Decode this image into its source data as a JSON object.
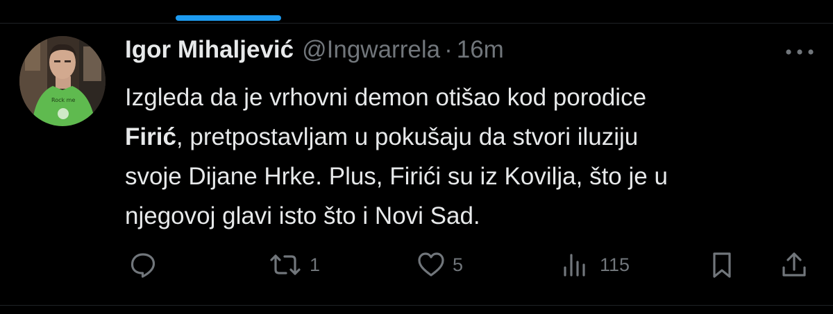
{
  "tweet": {
    "display_name": "Igor Mihaljević",
    "handle": "@Ingwarrela",
    "separator": "·",
    "time": "16m",
    "shirt_text": "Rock me",
    "body": {
      "line1": "Izgleda da je vrhovni demon otišao kod porodice",
      "line2_bold": "Firić",
      "line2_rest": ", pretpostavljam u pokušaju da stvori iluziju",
      "line3": "svoje Dijane Hrke. Plus, Firići su iz Kovilja, što je u",
      "line4": "njegovoj glavi isto što i Novi Sad."
    }
  },
  "actions": {
    "reply_icon": "speech-bubble",
    "retweet_icon": "retweet-arrows",
    "retweet_count": "1",
    "like_icon": "heart",
    "like_count": "5",
    "views_icon": "bar-chart",
    "views_count": "115",
    "bookmark_icon": "bookmark",
    "share_icon": "share-upload"
  },
  "colors": {
    "background": "#000000",
    "primary_text": "#e7e9ea",
    "secondary_text": "#71767b",
    "accent": "#1d9bf0"
  }
}
